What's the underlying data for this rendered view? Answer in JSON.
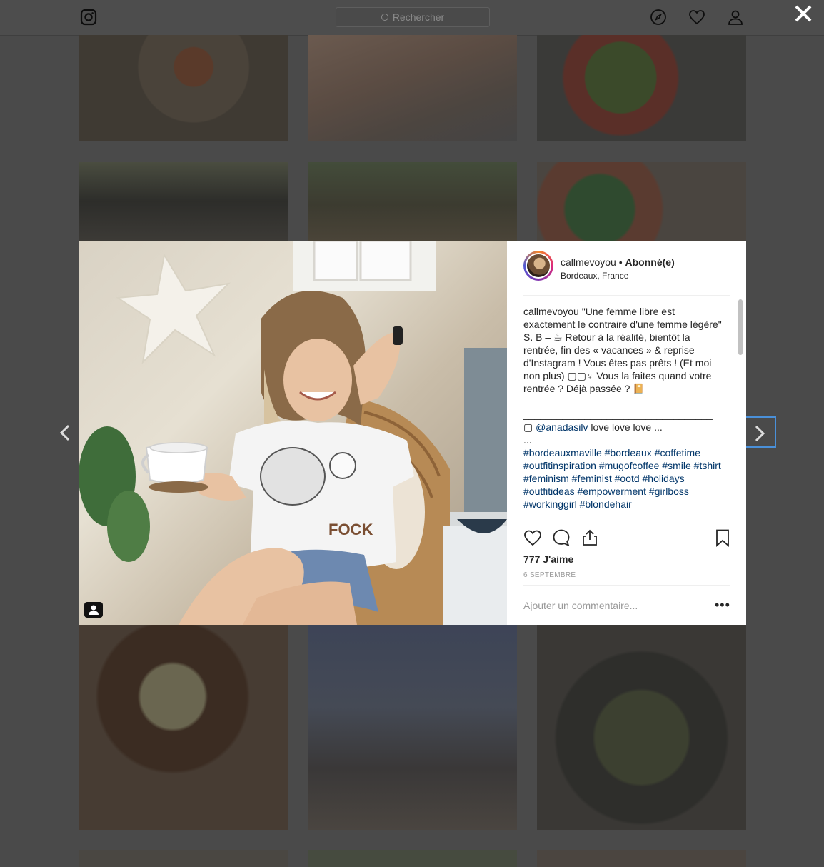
{
  "topbar": {
    "search_placeholder": "Rechercher",
    "icons": [
      "instagram-icon",
      "compass-icon",
      "heart-icon",
      "profile-icon"
    ]
  },
  "close_label": "close",
  "post": {
    "username": "callmevoyou",
    "separator": " • ",
    "follow_status": "Abonné(e)",
    "location": "Bordeaux, France",
    "caption_author": "callmevoyou",
    "caption_text": " \"Une femme libre est exactement le contraire d'une femme légère\" S. B – ☕ Retour à la réalité, bientôt la rentrée, fin des « vacances » & reprise d'Instagram ! Vous êtes pas prêts ! (Et moi non plus) ▢▢♀ Vous la faites quand votre rentrée ? Déjà passée ? 📔",
    "caption_rule": "__________________________________",
    "credit_prefix": "▢ ",
    "credit_mention": "@anadasilv",
    "credit_text": " love love love ...",
    "ellipsis": "...",
    "hashtags": "#bordeauxmaville #bordeaux #coffetime #outfitinspiration #mugofcoffee #smile #tshirt #feminism #feminist #ootd #holidays #outfitideas #empowerment #girlboss #workinggirl #blondehair",
    "likes": "777 J'aime",
    "date": "6 SEPTEMBRE",
    "comment_placeholder": "Ajouter un commentaire...",
    "more_label": "•••",
    "photo_shirt_text": "FOCK"
  },
  "colors": {
    "link": "#003569",
    "overlay": "#4a4a4a",
    "focus_outline": "#4a90d9"
  }
}
